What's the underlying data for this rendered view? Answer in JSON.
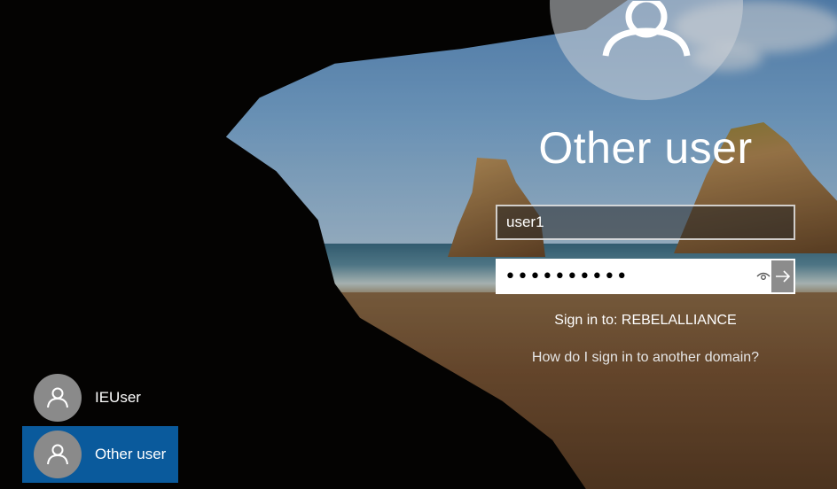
{
  "signin": {
    "title": "Other user",
    "username_value": "user1",
    "password_value": "••••••••••",
    "signin_to": "Sign in to: REBELALLIANCE",
    "other_domain_link": "How do I sign in to another domain?"
  },
  "users": [
    {
      "name": "IEUser",
      "selected": false
    },
    {
      "name": "Other user",
      "selected": true
    }
  ],
  "icons": {
    "big_avatar": "user-silhouette-icon",
    "reveal": "eye-icon",
    "submit": "arrow-right-icon"
  },
  "colors": {
    "selected_user": "#0a5a9c",
    "submit_button": "#787878"
  }
}
